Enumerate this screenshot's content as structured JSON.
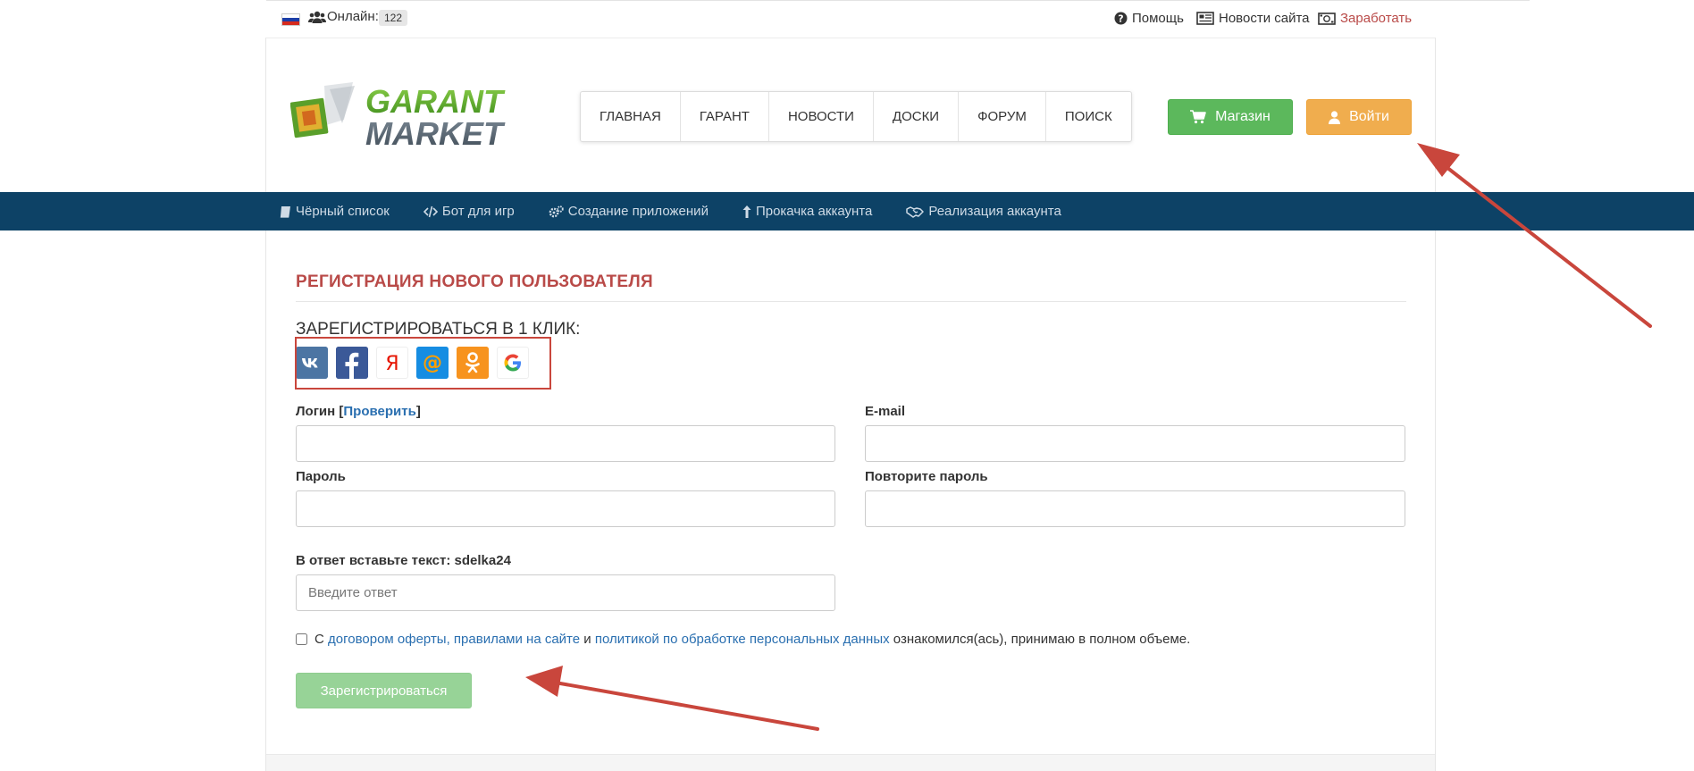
{
  "topbar": {
    "online_label": "Онлайн:",
    "online_count": "122",
    "links": [
      {
        "label": "Помощь",
        "icon": "question-circle-icon"
      },
      {
        "label": "Новости сайта",
        "icon": "newspaper-icon"
      },
      {
        "label": "Заработать",
        "icon": "money-icon"
      }
    ]
  },
  "logo": {
    "line1": "GARANT",
    "line2": "MARKET"
  },
  "mainnav": [
    "ГЛАВНАЯ",
    "ГАРАНТ",
    "НОВОСТИ",
    "ДОСКИ",
    "ФОРУМ",
    "ПОИСК"
  ],
  "header_buttons": {
    "shop": "Магазин",
    "login": "Войти"
  },
  "subnav": [
    {
      "label": "Чёрный список",
      "icon": "book-icon"
    },
    {
      "label": "Бот для игр",
      "icon": "code-icon"
    },
    {
      "label": "Создание приложений",
      "icon": "gears-icon"
    },
    {
      "label": "Прокачка аккаунта",
      "icon": "level-up-icon"
    },
    {
      "label": "Реализация аккаунта",
      "icon": "handshake-icon"
    }
  ],
  "form": {
    "title": "РЕГИСТРАЦИЯ НОВОГО ПОЛЬЗОВАТЕЛЯ",
    "oneclick_title": "ЗАРЕГИСТРИРОВАТЬСЯ В 1 КЛИК:",
    "social": [
      "vk",
      "facebook",
      "yandex",
      "mail-ru",
      "odnoklassniki",
      "google"
    ],
    "login_label": "Логин",
    "check_link": "Проверить",
    "email_label": "E-mail",
    "password_label": "Пароль",
    "repeat_password_label": "Повторите пароль",
    "captcha_label": "В ответ вставьте текст: sdelka24",
    "captcha_placeholder": "Введите ответ",
    "agree_prefix": "С",
    "agree_link1": "договором оферты, правилами на сайте",
    "agree_and": "и",
    "agree_link2": "политикой по обработке персональных данных",
    "agree_suffix": "ознакомился(ась), принимаю в полном объеме.",
    "submit": "Зарегистрироваться"
  },
  "colors": {
    "subnav_bg": "#0d4266",
    "title_red": "#b94a48",
    "shop_green": "#5cb85c",
    "login_orange": "#f0ad4e",
    "annotation_red": "#c9463c"
  }
}
